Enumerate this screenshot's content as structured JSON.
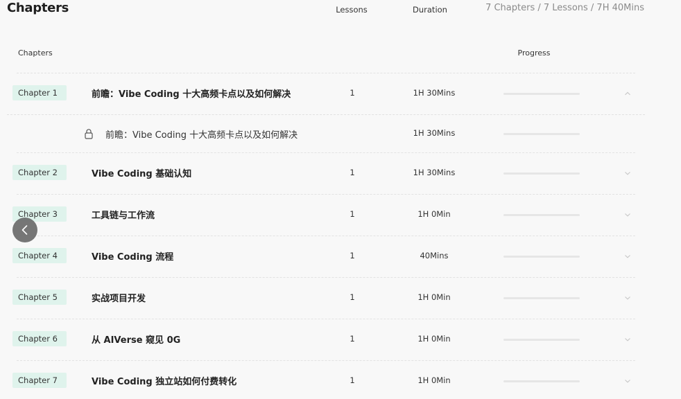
{
  "page": {
    "title": "Chapters",
    "summary": "7 Chapters / 7 Lessons / 7H 40Mins"
  },
  "columns": {
    "chapters": "Chapters",
    "lessons": "Lessons",
    "duration": "Duration",
    "progress": "Progress"
  },
  "chapters": [
    {
      "badge": "Chapter 1",
      "title": "前瞻：Vibe Coding 十大高频卡点以及如何解决",
      "lessons": "1",
      "duration": "1H 30Mins",
      "progress": 0,
      "expanded": true,
      "chevron_icon": "chevron-up-icon"
    },
    {
      "badge": "Chapter 2",
      "title": "Vibe Coding 基础认知",
      "lessons": "1",
      "duration": "1H 30Mins",
      "progress": 0,
      "expanded": false,
      "chevron_icon": "chevron-down-icon"
    },
    {
      "badge": "Chapter 3",
      "title": "工具链与工作流",
      "lessons": "1",
      "duration": "1H 0Min",
      "progress": 0,
      "expanded": false,
      "chevron_icon": "chevron-down-icon"
    },
    {
      "badge": "Chapter 4",
      "title": "Vibe Coding 流程",
      "lessons": "1",
      "duration": "40Mins",
      "progress": 0,
      "expanded": false,
      "chevron_icon": "chevron-down-icon"
    },
    {
      "badge": "Chapter 5",
      "title": "实战项目开发",
      "lessons": "1",
      "duration": "1H 0Min",
      "progress": 0,
      "expanded": false,
      "chevron_icon": "chevron-down-icon"
    },
    {
      "badge": "Chapter 6",
      "title": "从 AIVerse 窥见 0G",
      "lessons": "1",
      "duration": "1H 0Min",
      "progress": 0,
      "expanded": false,
      "chevron_icon": "chevron-down-icon"
    },
    {
      "badge": "Chapter 7",
      "title": "Vibe Coding 独立站如何付费转化",
      "lessons": "1",
      "duration": "1H 0Min",
      "progress": 0,
      "expanded": false,
      "chevron_icon": "chevron-down-icon"
    }
  ],
  "sub_lesson": {
    "title": "前瞻：Vibe Coding 十大高频卡点以及如何解决",
    "duration": "1H 30Mins",
    "progress": 0,
    "icon": "lock-icon"
  },
  "nav": {
    "back_icon": "chevron-left-icon"
  },
  "colors": {
    "badge_bg": "#dff3ec",
    "progress_track": "#e6e6e6",
    "back_button": "#6c6c6c"
  }
}
